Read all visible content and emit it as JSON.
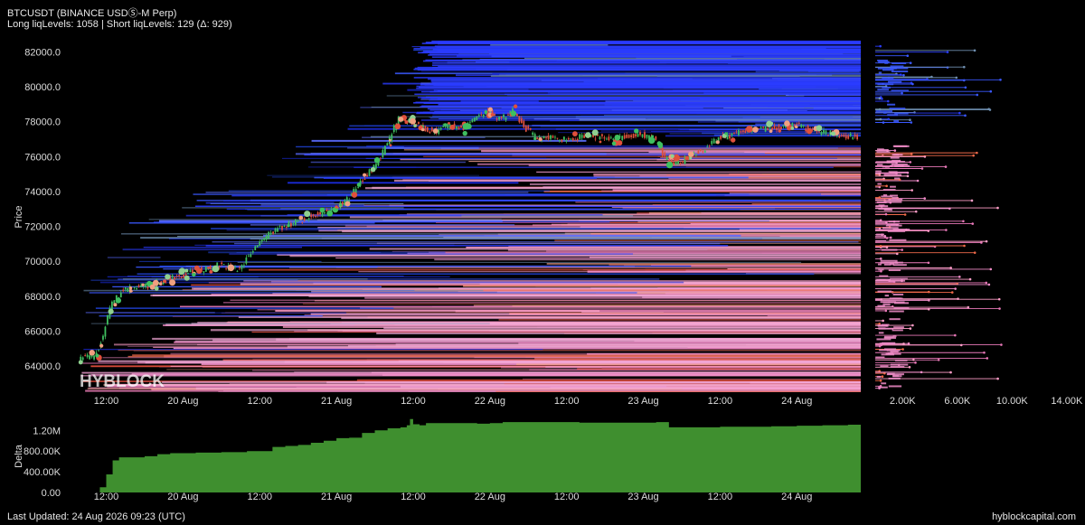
{
  "header": {
    "title": "BTCUSDT (BINANCE USDⓈ-M Perp)",
    "subtitle": "Long liqLevels: 1058 | Short liqLevels: 129 (Δ: 929)"
  },
  "footer": {
    "last_updated": "Last Updated: 24 Aug 2026 09:23 (UTC)",
    "site": "hyblockcapital.com"
  },
  "watermark": "HYBLOCK",
  "colors": {
    "background": "#000000",
    "short_levels": "#2a3cff",
    "long_levels": "#f08cc8",
    "long_levels_alt": "#f06a4a",
    "candle_up": "#3fbf5f",
    "candle_down": "#e0503c",
    "delta_fill": "#3f8f2f"
  },
  "chart_data": [
    {
      "type": "heatmap",
      "name": "price-liquidation-levels",
      "ylabel": "Price",
      "y_ticks": [
        "64000.0",
        "66000.0",
        "68000.0",
        "70000.0",
        "72000.0",
        "74000.0",
        "76000.0",
        "78000.0",
        "80000.0",
        "82000.0"
      ],
      "y_tick_values": [
        64000,
        66000,
        68000,
        70000,
        72000,
        74000,
        76000,
        78000,
        80000,
        82000
      ],
      "ylim": [
        62500,
        82800
      ],
      "x_ticks": [
        "12:00",
        "20 Aug",
        "12:00",
        "21 Aug",
        "12:00",
        "22 Aug",
        "12:00",
        "23 Aug",
        "12:00",
        "24 Aug"
      ],
      "x_tick_hours": [
        12,
        24,
        36,
        48,
        60,
        72,
        84,
        96,
        108,
        120
      ],
      "xlim_hours": [
        5,
        130
      ],
      "price_series": {
        "hours": [
          8,
          10,
          11,
          12,
          13,
          15,
          18,
          22,
          26,
          30,
          33,
          36,
          38,
          40,
          44,
          48,
          50,
          52,
          54,
          56,
          58,
          60,
          62,
          64,
          66,
          68,
          70,
          72,
          74,
          76,
          78,
          80,
          82,
          84,
          88,
          92,
          96,
          98,
          100,
          102,
          104,
          106,
          108,
          110,
          112,
          116,
          120,
          124,
          128,
          130
        ],
        "close": [
          64500,
          64500,
          64800,
          66000,
          67500,
          68400,
          68500,
          69000,
          69400,
          69800,
          69500,
          71000,
          71600,
          72000,
          72500,
          73000,
          73500,
          74500,
          75300,
          76500,
          78200,
          78000,
          77600,
          77400,
          77800,
          77600,
          78200,
          78600,
          78100,
          78600,
          77600,
          77000,
          77100,
          77000,
          77200,
          77000,
          77300,
          77000,
          75800,
          75600,
          76200,
          76400,
          77100,
          77200,
          77500,
          77600,
          77800,
          77400,
          77200,
          77100
        ]
      },
      "short_levels_band": [
        76800,
        82800
      ],
      "long_levels_band": [
        62500,
        76600
      ]
    },
    {
      "type": "area",
      "name": "delta",
      "ylabel": "Delta",
      "y_ticks": [
        "0.00",
        "400.00K",
        "800.00K",
        "1.20M"
      ],
      "y_tick_values": [
        0,
        400000,
        800000,
        1200000
      ],
      "ylim": [
        0,
        1450000
      ],
      "x_ticks": [
        "12:00",
        "20 Aug",
        "12:00",
        "21 Aug",
        "12:00",
        "22 Aug",
        "12:00",
        "23 Aug",
        "12:00",
        "24 Aug"
      ],
      "x_tick_hours": [
        12,
        24,
        36,
        48,
        60,
        72,
        84,
        96,
        108,
        120
      ],
      "hours": [
        5,
        8,
        10,
        11,
        12,
        13,
        14,
        16,
        18,
        20,
        22,
        26,
        30,
        34,
        36,
        38,
        40,
        42,
        44,
        46,
        48,
        50,
        52,
        54,
        56,
        58,
        59,
        59.5,
        60,
        61,
        62,
        66,
        70,
        72,
        74,
        78,
        82,
        86,
        90,
        94,
        96,
        98,
        100,
        104,
        108,
        112,
        116,
        120,
        124,
        128,
        130
      ],
      "values": [
        0,
        0,
        0,
        100000,
        350000,
        620000,
        680000,
        680000,
        700000,
        740000,
        760000,
        770000,
        780000,
        800000,
        800000,
        880000,
        900000,
        920000,
        960000,
        1000000,
        1050000,
        1060000,
        1150000,
        1200000,
        1240000,
        1260000,
        1300000,
        1420000,
        1320000,
        1300000,
        1340000,
        1340000,
        1330000,
        1340000,
        1360000,
        1360000,
        1360000,
        1350000,
        1350000,
        1350000,
        1350000,
        1360000,
        1260000,
        1260000,
        1270000,
        1270000,
        1280000,
        1290000,
        1300000,
        1310000,
        1310000
      ]
    },
    {
      "type": "bar",
      "name": "liquidation-volume-profile",
      "x_ticks": [
        "2.00K",
        "6.00K",
        "10.00K",
        "14.00K"
      ],
      "x_tick_values": [
        2000,
        6000,
        10000,
        14000
      ],
      "xlim": [
        0,
        15000
      ]
    }
  ]
}
